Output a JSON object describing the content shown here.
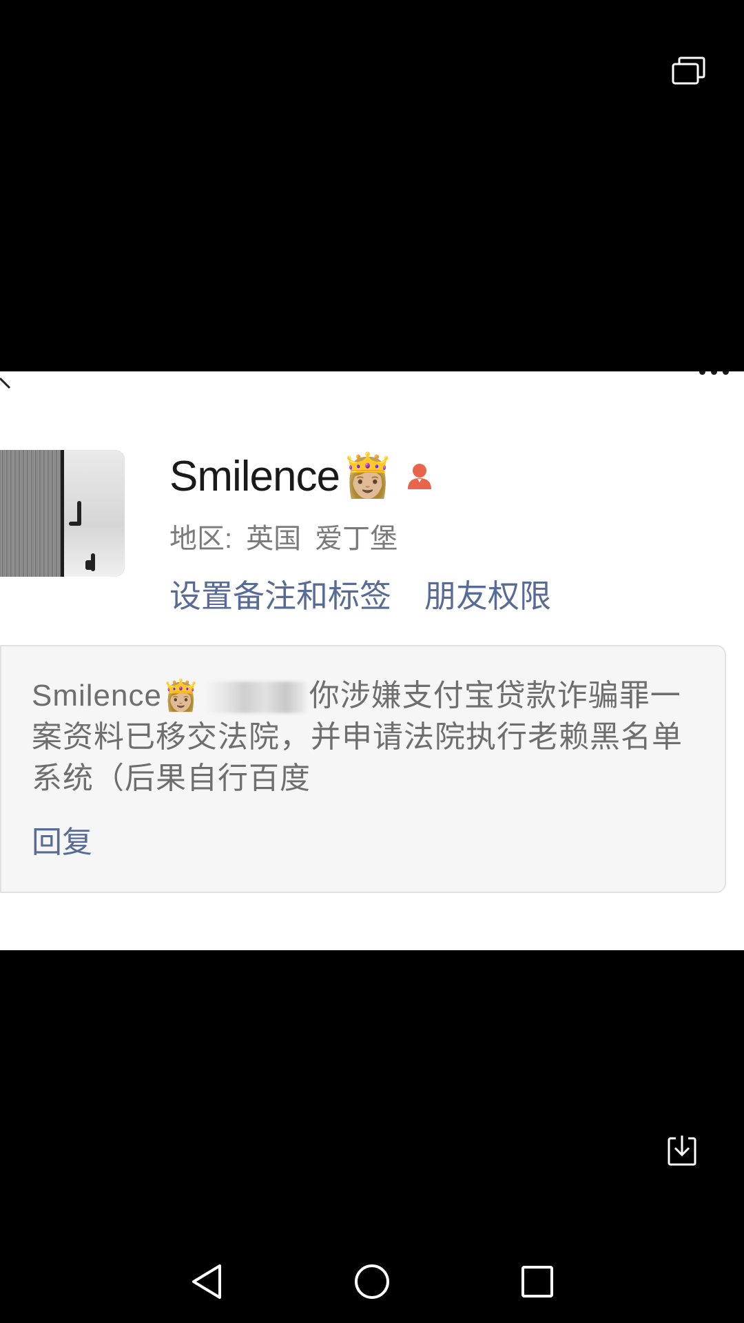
{
  "profile": {
    "nickname": "Smilence",
    "nickname_emoji": "👸🏼",
    "gender_icon": "female-user-icon",
    "region_label": "地区:",
    "region_country": "英国",
    "region_city": "爱丁堡",
    "link_set_remark": "设置备注和标签",
    "link_permissions": "朋友权限"
  },
  "comment": {
    "author": "Smilence",
    "author_emoji": "👸🏼",
    "text_after_blur": "你涉嫌支付宝贷款诈骗罪一案资料已移交法院，并申请法院执行老赖黑名单系统（后果自行百度",
    "reply_label": "回复"
  },
  "colors": {
    "link": "#576b95",
    "background": "#000000",
    "panel": "#ffffff",
    "gender_icon": "#e8644a"
  }
}
